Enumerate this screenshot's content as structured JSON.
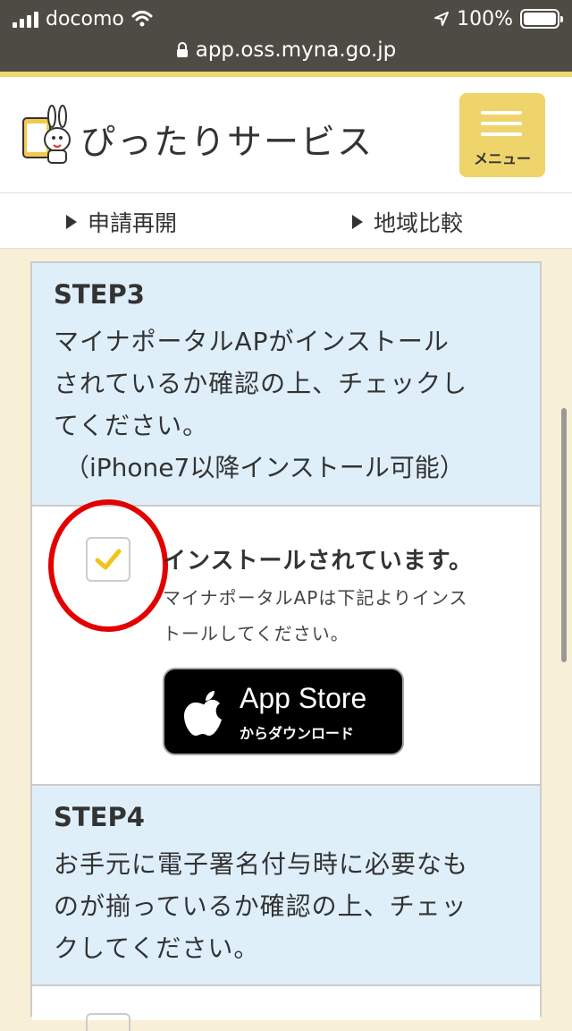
{
  "status_bar": {
    "carrier": "docomo",
    "battery": "100%",
    "url": "app.oss.myna.go.jp"
  },
  "header": {
    "title": "ぴったりサービス",
    "menu_label": "メニュー"
  },
  "subnav": {
    "items": [
      {
        "label": "申請再開"
      },
      {
        "label": "地域比較"
      }
    ]
  },
  "step3": {
    "title": "STEP3",
    "desc_lines": [
      "マイナポータルAPがインストール",
      "されているか確認の上、チェックし",
      "てください。"
    ],
    "note": "（iPhone7以降インストール可能）",
    "checkbox_checked": true,
    "checkbox_label": "インストールされています。",
    "checkbox_note_lines": [
      "マイナポータルAPは下記よりインス",
      "トールしてください。"
    ],
    "appstore_big": "App Store",
    "appstore_small": "からダウンロード"
  },
  "step4": {
    "title": "STEP4",
    "desc_lines": [
      "お手元に電子署名付与時に必要なも",
      "のが揃っているか確認の上、チェッ",
      "クしてください。"
    ]
  },
  "colors": {
    "accent_yellow": "#efd46c",
    "step_blue": "#dfeffa",
    "highlight_red": "#e30000",
    "check_yellow": "#f0c419"
  }
}
